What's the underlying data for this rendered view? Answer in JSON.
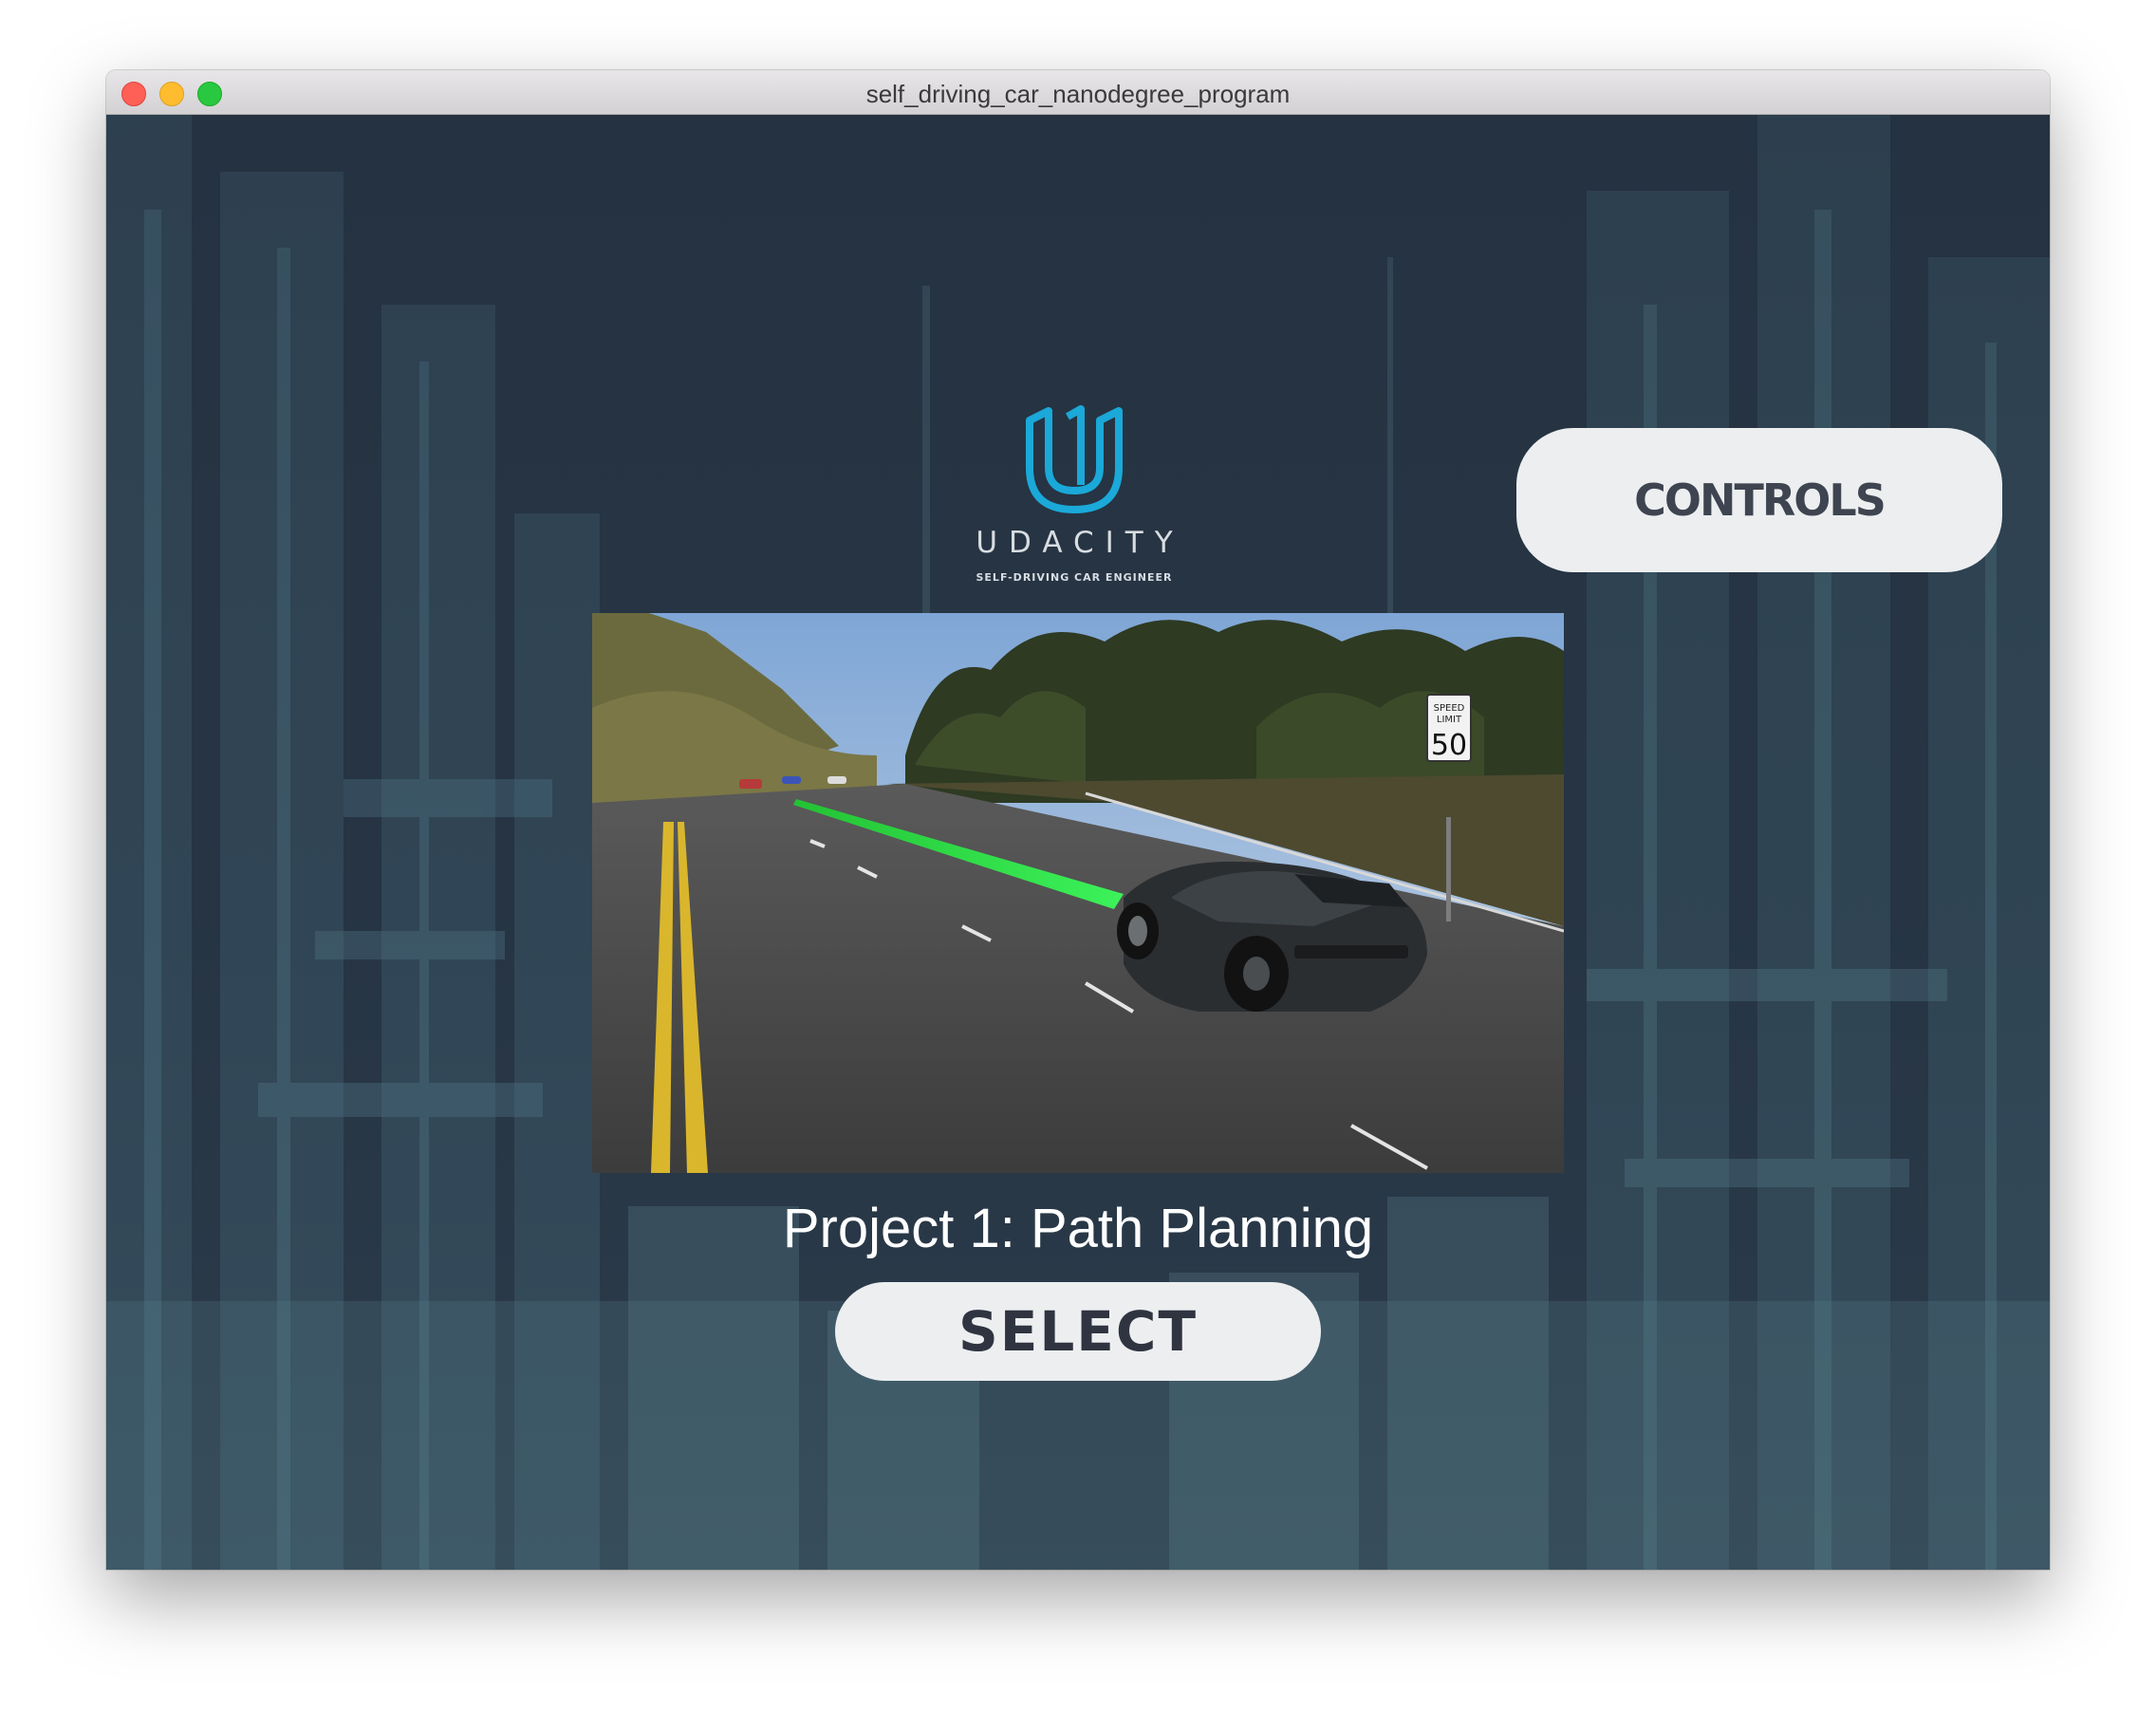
{
  "window": {
    "title": "self_driving_car_nanodegree_program"
  },
  "logo": {
    "icon": "udacity-u-icon",
    "wordmark": "UDACITY",
    "subtitle": "SELF-DRIVING CAR ENGINEER",
    "color": "#1aa9d8"
  },
  "controls_button": {
    "label": "CONTROLS"
  },
  "project": {
    "title": "Project 1: Path Planning",
    "preview": {
      "sign_top": "SPEED LIMIT",
      "sign_value": "50"
    }
  },
  "select_button": {
    "label": "SELECT"
  },
  "colors": {
    "background": "#253241",
    "button": "#eceef0",
    "path_highlight": "#2ee83c"
  }
}
